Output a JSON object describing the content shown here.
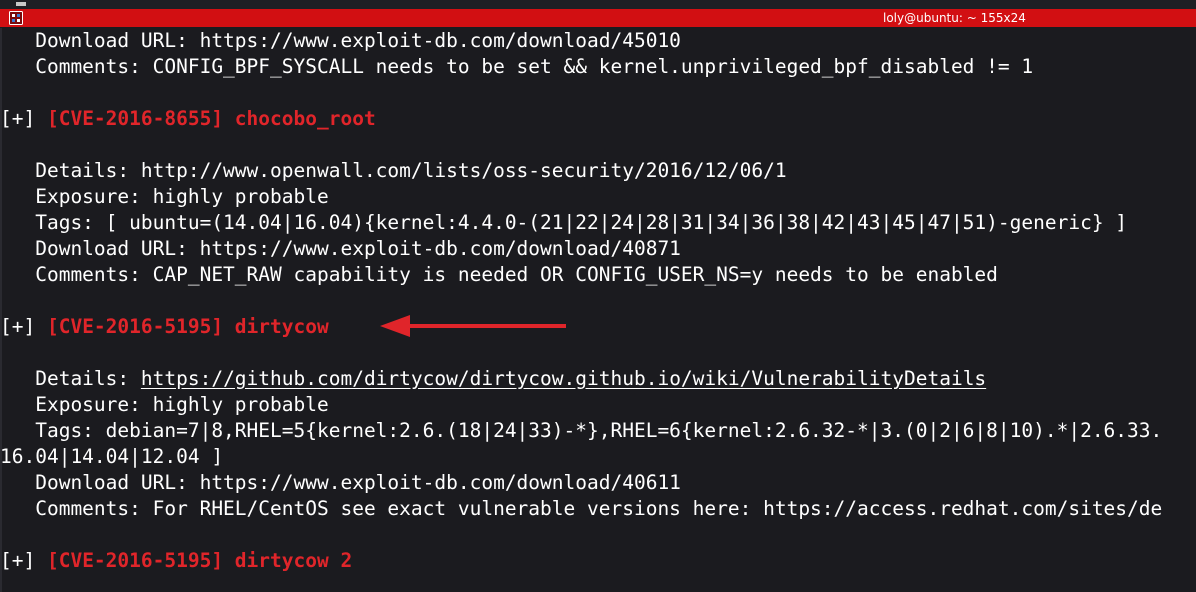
{
  "window": {
    "title": "loly@ubuntu: ~ 155x24",
    "icon": "terminal-icon",
    "accent": "#d20f12"
  },
  "colors": {
    "background": "#1b1b1f",
    "text": "#ffffff",
    "cve_highlight": "#e0252a",
    "arrow": "#e0252a"
  },
  "terminal": {
    "lines": [
      {
        "segments": [
          {
            "text": "   Download URL: https://www.exploit-db.com/download/45010"
          }
        ]
      },
      {
        "segments": [
          {
            "text": "   Comments: CONFIG_BPF_SYSCALL needs to be set && kernel.unprivileged_bpf_disabled != 1"
          }
        ]
      },
      {
        "segments": [
          {
            "text": ""
          }
        ]
      },
      {
        "segments": [
          {
            "text": "[+] "
          },
          {
            "text": "[CVE-2016-8655] chocobo_root",
            "style": "red"
          }
        ]
      },
      {
        "segments": [
          {
            "text": ""
          }
        ]
      },
      {
        "segments": [
          {
            "text": "   Details: http://www.openwall.com/lists/oss-security/2016/12/06/1"
          }
        ]
      },
      {
        "segments": [
          {
            "text": "   Exposure: highly probable"
          }
        ]
      },
      {
        "segments": [
          {
            "text": "   Tags: [ ubuntu=(14.04|16.04){kernel:4.4.0-(21|22|24|28|31|34|36|38|42|43|45|47|51)-generic} ]"
          }
        ]
      },
      {
        "segments": [
          {
            "text": "   Download URL: https://www.exploit-db.com/download/40871"
          }
        ]
      },
      {
        "segments": [
          {
            "text": "   Comments: CAP_NET_RAW capability is needed OR CONFIG_USER_NS=y needs to be enabled"
          }
        ]
      },
      {
        "segments": [
          {
            "text": ""
          }
        ]
      },
      {
        "segments": [
          {
            "text": "[+] "
          },
          {
            "text": "[CVE-2016-5195] dirtycow",
            "style": "red"
          }
        ]
      },
      {
        "segments": [
          {
            "text": ""
          }
        ]
      },
      {
        "segments": [
          {
            "text": "   Details: "
          },
          {
            "text": "https://github.com/dirtycow/dirtycow.github.io/wiki/VulnerabilityDetails",
            "style": "underline"
          }
        ]
      },
      {
        "segments": [
          {
            "text": "   Exposure: highly probable"
          }
        ]
      },
      {
        "segments": [
          {
            "text": "   Tags: debian=7|8,RHEL=5{kernel:2.6.(18|24|33)-*},RHEL=6{kernel:2.6.32-*|3.(0|2|6|8|10).*|2.6.33."
          }
        ]
      },
      {
        "segments": [
          {
            "text": "16.04|14.04|12.04 ]"
          }
        ]
      },
      {
        "segments": [
          {
            "text": "   Download URL: https://www.exploit-db.com/download/40611"
          }
        ]
      },
      {
        "segments": [
          {
            "text": "   Comments: For RHEL/CentOS see exact vulnerable versions here: https://access.redhat.com/sites/de"
          }
        ]
      },
      {
        "segments": [
          {
            "text": ""
          }
        ]
      },
      {
        "segments": [
          {
            "text": "[+] "
          },
          {
            "text": "[CVE-2016-5195] dirtycow 2",
            "style": "red"
          }
        ]
      }
    ]
  },
  "annotation": {
    "arrow_icon": "left-arrow-icon",
    "points_to": "[CVE-2016-5195] dirtycow"
  }
}
